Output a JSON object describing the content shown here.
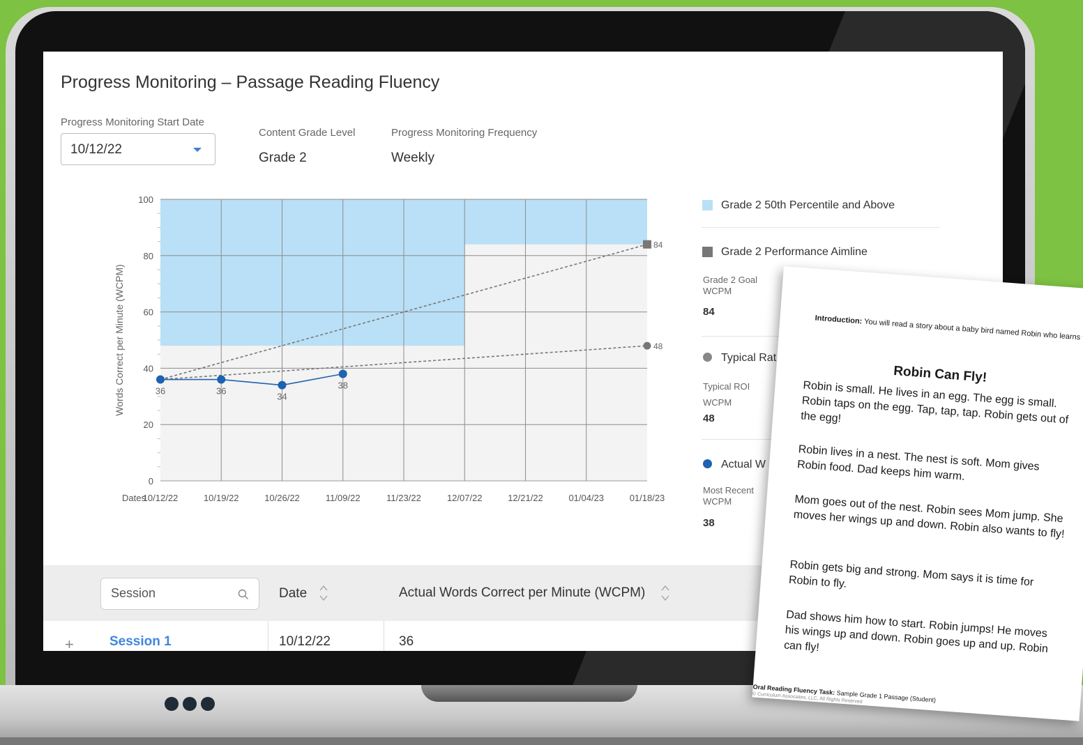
{
  "header": {
    "title": "Progress Monitoring – Passage Reading Fluency"
  },
  "filters": {
    "start_date_label": "Progress Monitoring Start Date",
    "start_date_value": "10/12/22",
    "grade_label": "Content Grade Level",
    "grade_value": "Grade 2",
    "frequency_label": "Progress Monitoring Frequency",
    "frequency_value": "Weekly"
  },
  "chart_data": {
    "type": "line",
    "ylabel": "Words Correct per Minute (WCPM)",
    "xlabel": "Dates",
    "ylim": [
      0,
      100
    ],
    "yticks": [
      0,
      20,
      40,
      60,
      80,
      100
    ],
    "categories": [
      "10/12/22",
      "10/19/22",
      "10/26/22",
      "11/09/22",
      "11/23/22",
      "12/07/22",
      "12/21/22",
      "01/04/23",
      "01/18/23"
    ],
    "band": {
      "name": "Grade 2 50th Percentile and Above",
      "color": "#b9e0f6",
      "segments": [
        {
          "from": "10/12/22",
          "to": "12/07/22",
          "lower": 48
        },
        {
          "from": "12/07/22",
          "to": "01/18/23",
          "lower": 84
        }
      ]
    },
    "series": [
      {
        "name": "Grade 2  Performance Aimline",
        "style": "dashed",
        "color": "#777777",
        "marker": "square",
        "points": [
          {
            "x": "10/12/22",
            "y": 36
          },
          {
            "x": "01/18/23",
            "y": 84,
            "label": "84"
          }
        ]
      },
      {
        "name": "Typical Rate",
        "style": "dashed",
        "color": "#777777",
        "marker": "circle",
        "points": [
          {
            "x": "10/12/22",
            "y": 36
          },
          {
            "x": "01/18/23",
            "y": 48,
            "label": "48"
          }
        ]
      },
      {
        "name": "Actual WCPM",
        "style": "solid",
        "color": "#1e62b0",
        "marker": "circle",
        "points": [
          {
            "x": "10/12/22",
            "y": 36,
            "label": "36"
          },
          {
            "x": "10/19/22",
            "y": 36,
            "label": "36"
          },
          {
            "x": "10/26/22",
            "y": 34,
            "label": "34"
          },
          {
            "x": "11/09/22",
            "y": 38,
            "label": "38"
          }
        ]
      }
    ],
    "grid": true,
    "legend": "right"
  },
  "legend": {
    "percentile": "Grade 2 50th Percentile and Above",
    "aimline": "Grade 2  Performance Aimline",
    "goal_label": "Grade 2 Goal  WCPM",
    "goal_value": "84",
    "typical": "Typical Rat",
    "typical_roi_label": "Typical ROI",
    "typical_wcpm_label": "WCPM",
    "typical_value": "48",
    "actual": "Actual W",
    "recent_label": "Most Recent WCPM",
    "recent_value": "38",
    "colors": {
      "percentile": "#b9e0f6",
      "aimline": "#777777",
      "typical": "#888888",
      "actual": "#1e62b0"
    }
  },
  "table": {
    "session_placeholder": "Session",
    "date_header": "Date",
    "wcpm_header": "Actual Words Correct per Minute (WCPM)",
    "rows": [
      {
        "expand": "+",
        "session": "Session 1",
        "date": "10/12/22",
        "wcpm": "36"
      }
    ]
  },
  "passage": {
    "intro_label": "Introduction:",
    "intro_text": " You will read a story about a baby bird named Robin who learns to fly.",
    "title": "Robin Can Fly!",
    "paragraphs": [
      "Robin is small. He lives in an egg. The egg is small. Robin taps on the egg. Tap, tap, tap. Robin gets out of the egg!",
      "Robin lives in a nest. The nest is soft. Mom gives Robin food. Dad keeps him warm.",
      "Mom goes out of the nest. Robin sees Mom jump. She moves her wings up and down. Robin also wants to fly!",
      "Robin gets big and strong. Mom says it is time for Robin to fly.",
      "Dad shows him how to start. Robin jumps! He moves his wings up and down. Robin goes up and up. Robin can fly!"
    ],
    "footer_label": "Oral Reading Fluency Task:",
    "footer_text": " Sample Grade 1 Passage (Student)",
    "copyright": "© Curriculum Associates, LLC, All Rights Reserved"
  }
}
